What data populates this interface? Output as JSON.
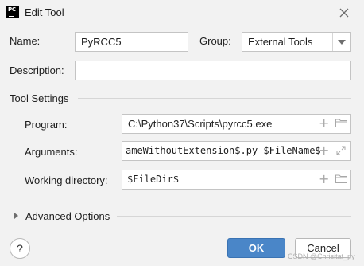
{
  "window": {
    "title": "Edit Tool",
    "app_icon_text": "PC"
  },
  "form": {
    "name_label": "Name:",
    "name_value": "PyRCC5",
    "group_label": "Group:",
    "group_value": "External Tools",
    "description_label": "Description:",
    "description_value": ""
  },
  "tool_settings": {
    "header": "Tool Settings",
    "program_label": "Program:",
    "program_value": "C:\\Python37\\Scripts\\pyrcc5.exe",
    "arguments_label": "Arguments:",
    "arguments_value": "ameWithoutExtension$.py $FileName$",
    "working_dir_label": "Working directory:",
    "working_dir_value": "$FileDir$"
  },
  "advanced": {
    "label": "Advanced Options"
  },
  "footer": {
    "help_label": "?",
    "ok_label": "OK",
    "cancel_label": "Cancel",
    "watermark": "CSDN @Chrisitat_py"
  },
  "colors": {
    "primary_button": "#4a86c8",
    "background": "#f2f2f2"
  },
  "icons": [
    "app-icon",
    "close-icon",
    "dropdown-icon",
    "add-icon",
    "folder-icon",
    "expand-icon",
    "help-icon"
  ]
}
